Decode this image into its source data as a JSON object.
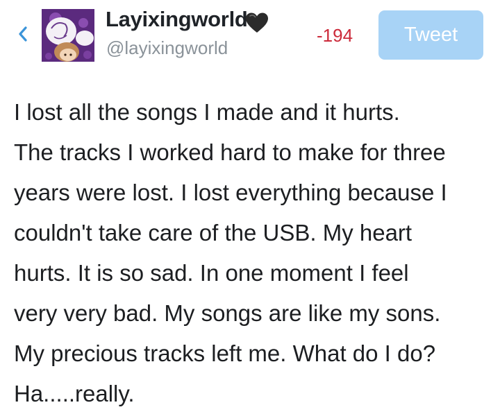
{
  "header": {
    "back_icon": "chevron-left-icon",
    "avatar_icon": "avatar-image",
    "display_name": "Layixingworld",
    "name_badge_icon": "black-heart-icon",
    "handle": "@layixingworld",
    "char_count": "-194",
    "tweet_button_label": "Tweet"
  },
  "composer": {
    "text": "I lost all the songs I made and it hurts.\nThe tracks I worked hard to make for three\nyears were lost. I lost everything because I\ncouldn't take care of the USB. My heart\nhurts. It is so sad. In one moment I feel\nvery very bad. My songs are like my sons.\nMy precious tracks left me. What do I do?\nHa.....really."
  },
  "colors": {
    "back_icon": "#3b94d9",
    "char_count": "#cc2a3a",
    "tweet_button_bg": "#a8d3f6",
    "avatar_bg": "#5b2a7e",
    "text": "#1c1e21",
    "handle": "#8a9299"
  }
}
